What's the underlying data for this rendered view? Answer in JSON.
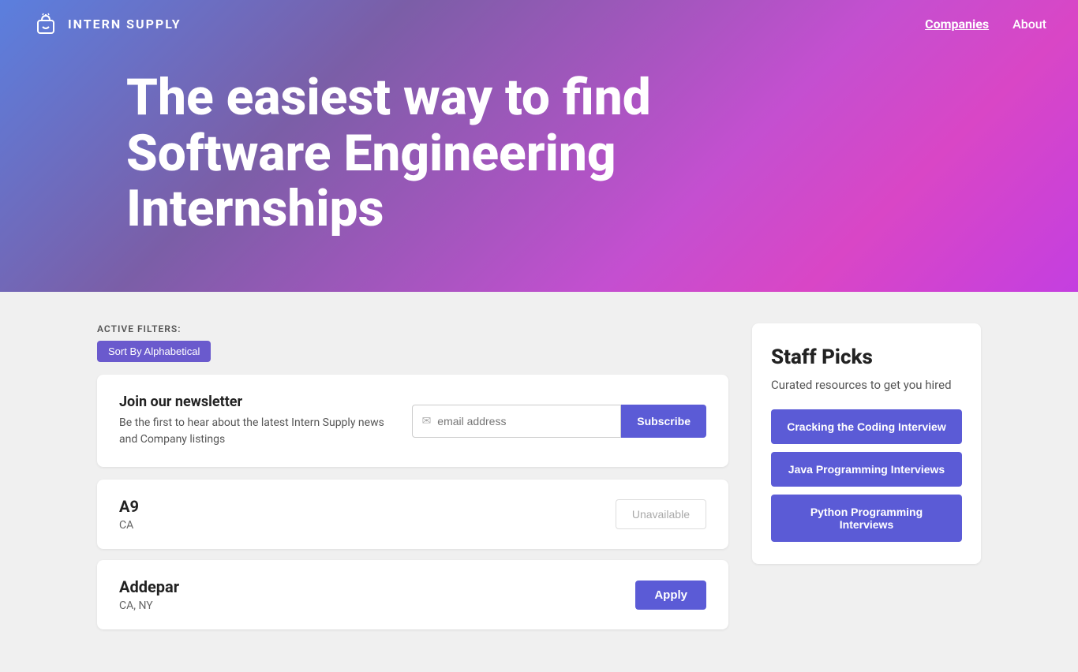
{
  "nav": {
    "logo_text": "INTERN SUPPLY",
    "links": [
      {
        "label": "Companies",
        "active": true
      },
      {
        "label": "About",
        "active": false
      }
    ]
  },
  "hero": {
    "title": "The easiest way to find Software Engineering Internships"
  },
  "filters": {
    "label": "ACTIVE FILTERS:",
    "tags": [
      {
        "label": "Sort By Alphabetical"
      }
    ]
  },
  "newsletter": {
    "title": "Join our newsletter",
    "description": "Be the first to hear about the latest Intern Supply news and Company listings",
    "email_placeholder": "email address",
    "subscribe_label": "Subscribe"
  },
  "companies": [
    {
      "name": "A9",
      "location": "CA",
      "action": "unavailable",
      "action_label": "Unavailable"
    },
    {
      "name": "Addepar",
      "location": "CA, NY",
      "action": "apply",
      "action_label": "Apply"
    }
  ],
  "staff_picks": {
    "title": "Staff Picks",
    "description": "Curated resources to get you hired",
    "items": [
      {
        "label": "Cracking the Coding Interview"
      },
      {
        "label": "Java Programming Interviews"
      },
      {
        "label": "Python Programming Interviews"
      }
    ]
  }
}
